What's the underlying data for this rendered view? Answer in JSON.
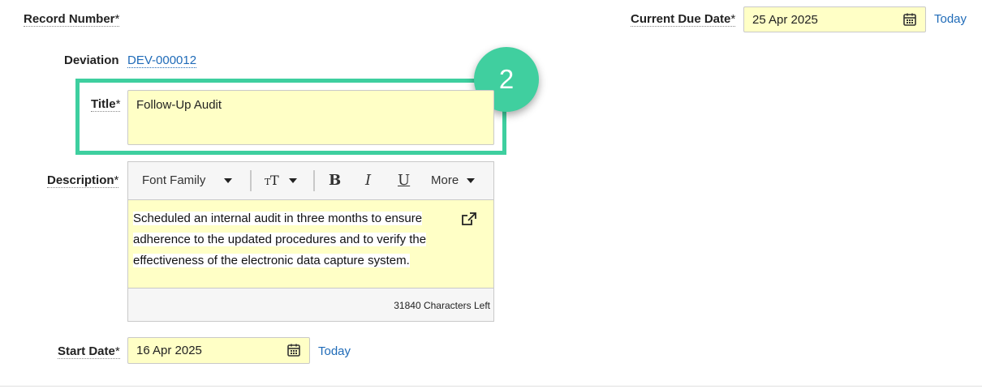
{
  "form": {
    "record_number": {
      "label": "Record Number",
      "required": "*"
    },
    "current_due_date": {
      "label": "Current Due Date",
      "required": "*",
      "value": "25 Apr 2025",
      "today_link": "Today"
    },
    "deviation": {
      "label": "Deviation",
      "value": "DEV-000012"
    },
    "title": {
      "label": "Title",
      "required": "*",
      "value": "Follow-Up Audit"
    },
    "description": {
      "label": "Description",
      "required": "*",
      "toolbar": {
        "font_family": "Font Family",
        "more": "More"
      },
      "lines": [
        "Scheduled an internal audit in three months to ensure",
        "adherence to the updated procedures and to verify the",
        "effectiveness of the electronic data capture system."
      ],
      "chars_left": "31840 Characters Left"
    },
    "start_date": {
      "label": "Start Date",
      "required": "*",
      "value": "16 Apr 2025",
      "today_link": "Today"
    }
  },
  "annotation": {
    "step_number": "2",
    "color": "#3ecf9f"
  },
  "icons": [
    "calendar-icon",
    "external-link-icon",
    "bold-icon",
    "italic-icon",
    "underline-icon",
    "text-size-icon"
  ]
}
